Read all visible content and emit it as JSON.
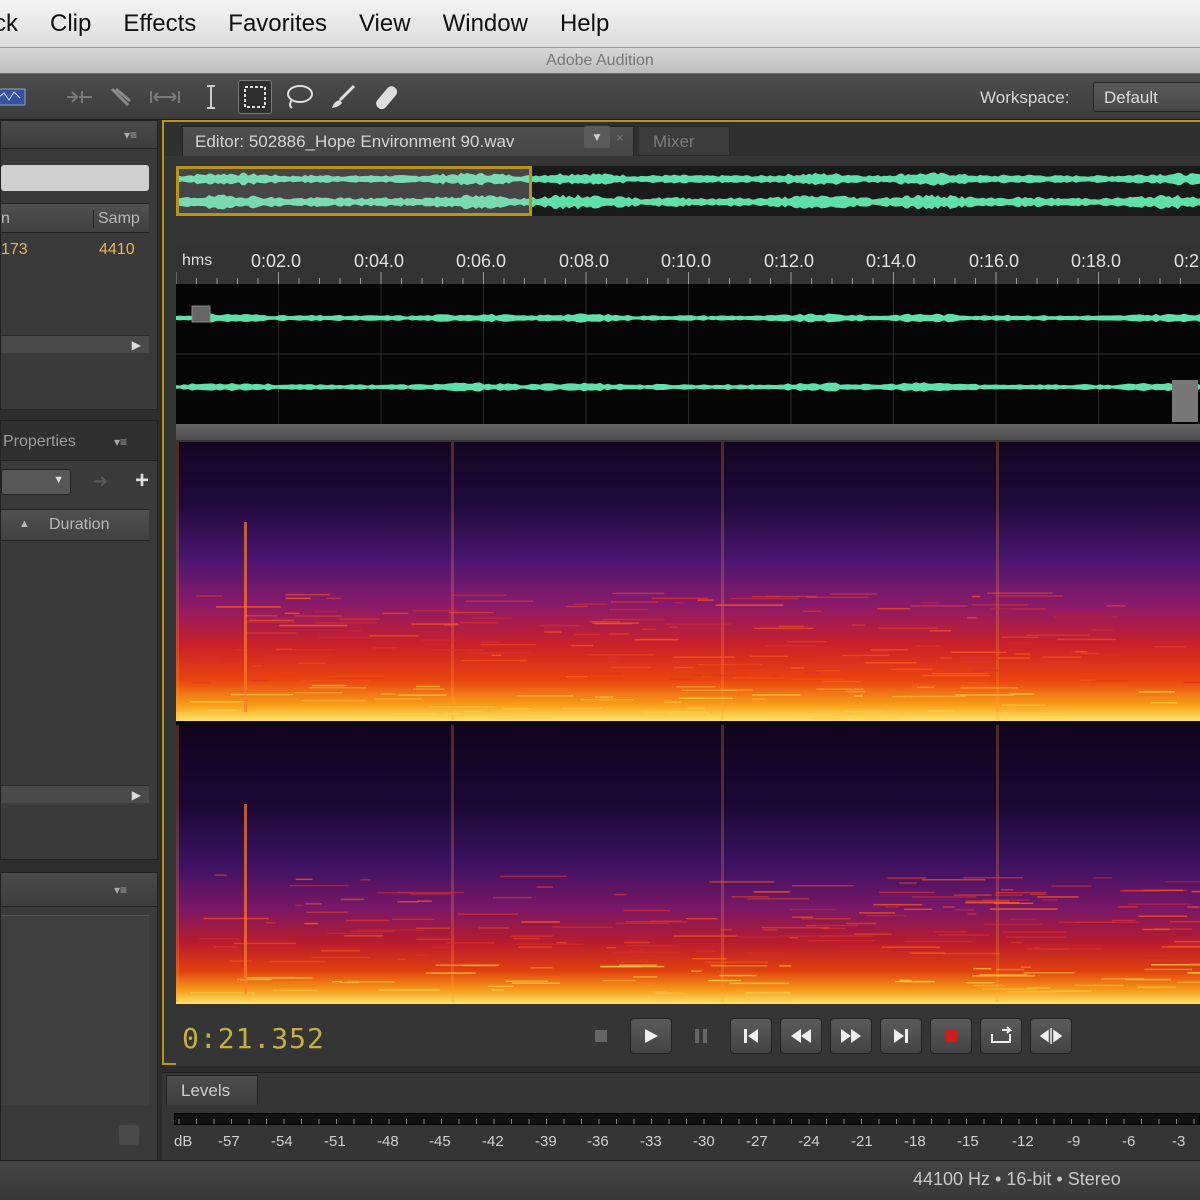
{
  "menu": [
    "ck",
    "Clip",
    "Effects",
    "Favorites",
    "View",
    "Window",
    "Help"
  ],
  "app_title": "Adobe Audition",
  "toolbar": {
    "workspace_label": "Workspace:",
    "workspace_value": "Default"
  },
  "files_panel": {
    "col_name": "n",
    "col_sample": "Samp",
    "row_value": "173",
    "row_sample": "4410"
  },
  "markers_panel": {
    "title": "Properties",
    "col_duration": "Duration"
  },
  "editor": {
    "tab_label": "Editor: 502886_Hope Environment 90.wav",
    "mixer_label": "Mixer",
    "ruler_unit": "hms",
    "ruler_ticks": [
      "0:02.0",
      "0:04.0",
      "0:06.0",
      "0:08.0",
      "0:10.0",
      "0:12.0",
      "0:14.0",
      "0:16.0",
      "0:18.0",
      "0:2"
    ],
    "timecode": "0:21.352"
  },
  "levels": {
    "tab_label": "Levels",
    "scale": [
      "dB",
      "-57",
      "-54",
      "-51",
      "-48",
      "-45",
      "-42",
      "-39",
      "-36",
      "-33",
      "-30",
      "-27",
      "-24",
      "-21",
      "-18",
      "-15",
      "-12",
      "-9",
      "-6",
      "-3"
    ]
  },
  "status": {
    "text": "44100 Hz • 16-bit • Stereo"
  },
  "colors": {
    "waveform": "#5fe0a8",
    "selection": "#b8941a",
    "timecode": "#c2b041"
  }
}
